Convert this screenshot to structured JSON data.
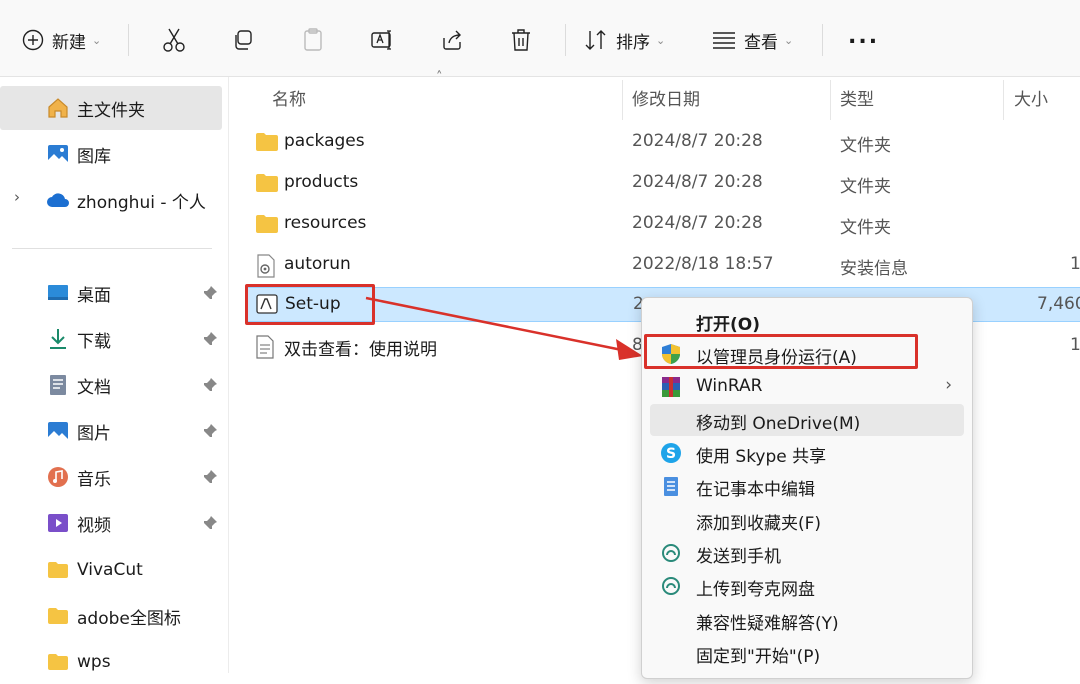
{
  "toolbar": {
    "new_label": "新建",
    "sort_label": "排序",
    "view_label": "查看",
    "more_label": "..."
  },
  "sidebar": {
    "home": "主文件夹",
    "gallery": "图库",
    "cloud": "zhonghui - 个人",
    "items": [
      {
        "label": "桌面"
      },
      {
        "label": "下载"
      },
      {
        "label": "文档"
      },
      {
        "label": "图片"
      },
      {
        "label": "音乐"
      },
      {
        "label": "视频"
      },
      {
        "label": "VivaCut"
      },
      {
        "label": "adobe全图标"
      },
      {
        "label": "wps"
      }
    ]
  },
  "columns": {
    "name": "名称",
    "date": "修改日期",
    "type": "类型",
    "size": "大小"
  },
  "files": [
    {
      "name": "packages",
      "date": "2024/8/7 20:28",
      "type": "文件夹",
      "size": ""
    },
    {
      "name": "products",
      "date": "2024/8/7 20:28",
      "type": "文件夹",
      "size": ""
    },
    {
      "name": "resources",
      "date": "2024/8/7 20:28",
      "type": "文件夹",
      "size": ""
    },
    {
      "name": "autorun",
      "date": "2022/8/18 18:57",
      "type": "安装信息",
      "size": "1"
    },
    {
      "name": "Set-up",
      "date": "2",
      "type": "",
      "size": "7,460"
    },
    {
      "name": "双击查看：使用说明",
      "date": "8",
      "type": "",
      "size": "1"
    }
  ],
  "context_menu": {
    "items": [
      {
        "label": "打开(O)"
      },
      {
        "label": "以管理员身份运行(A)"
      },
      {
        "label": "WinRAR"
      },
      {
        "label": "移动到 OneDrive(M)"
      },
      {
        "label": "使用 Skype 共享"
      },
      {
        "label": "在记事本中编辑"
      },
      {
        "label": "添加到收藏夹(F)"
      },
      {
        "label": "发送到手机"
      },
      {
        "label": "上传到夸克网盘"
      },
      {
        "label": "兼容性疑难解答(Y)"
      },
      {
        "label": "固定到\"开始\"(P)"
      }
    ]
  },
  "colors": {
    "accent": "#0067c0",
    "highlight": "#d9312a",
    "selection": "#cce8ff"
  }
}
